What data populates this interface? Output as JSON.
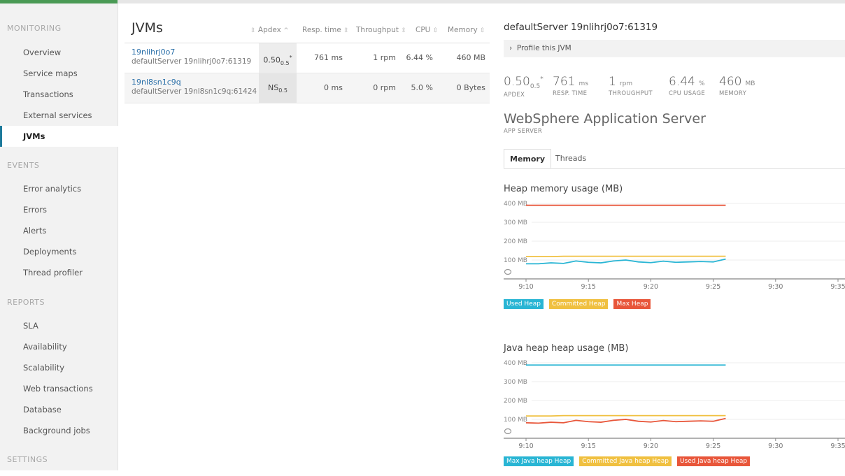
{
  "sidebar": {
    "sections": [
      {
        "label": "MONITORING",
        "items": [
          "Overview",
          "Service maps",
          "Transactions",
          "External services",
          "JVMs"
        ]
      },
      {
        "label": "EVENTS",
        "items": [
          "Error analytics",
          "Errors",
          "Alerts",
          "Deployments",
          "Thread profiler"
        ]
      },
      {
        "label": "REPORTS",
        "items": [
          "SLA",
          "Availability",
          "Scalability",
          "Web transactions",
          "Database",
          "Background jobs"
        ]
      },
      {
        "label": "SETTINGS",
        "items": []
      }
    ],
    "active_item": "JVMs"
  },
  "jvm_table": {
    "title": "JVMs",
    "columns": [
      "Apdex",
      "Resp. time",
      "Throughput",
      "CPU",
      "Memory"
    ],
    "rows": [
      {
        "name": "19nlihrj0o7",
        "server": "defaultServer 19nlihrj0o7:61319",
        "apdex": "0.50",
        "apdex_t": "0.5",
        "apdex_star": "*",
        "resp": "761 ms",
        "throughput": "1 rpm",
        "cpu": "6.44 %",
        "memory": "460 MB"
      },
      {
        "name": "19nl8sn1c9q",
        "server": "defaultServer 19nl8sn1c9q:61424",
        "apdex": "NS",
        "apdex_t": "0.5",
        "apdex_star": "",
        "resp": "0 ms",
        "throughput": "0 rpm",
        "cpu": "5.0 %",
        "memory": "0 Bytes"
      }
    ]
  },
  "detail": {
    "title": "defaultServer 19nlihrj0o7:61319",
    "profile_link": "Profile this JVM",
    "metrics": [
      {
        "value": "0.50",
        "sub": "0.5",
        "star": "*",
        "unit": "",
        "label": "APDEX"
      },
      {
        "value": "761",
        "unit": "ms",
        "label": "RESP. TIME"
      },
      {
        "value": "1",
        "unit": "rpm",
        "label": "THROUGHPUT"
      },
      {
        "value": "6.44",
        "unit": "%",
        "label": "CPU USAGE"
      },
      {
        "value": "460",
        "unit": "MB",
        "label": "MEMORY"
      }
    ],
    "server_name": "WebSphere Application Server",
    "server_kind": "APP SERVER",
    "tabs": [
      "Memory",
      "Threads"
    ],
    "active_tab": "Memory"
  },
  "chart_data": [
    {
      "type": "line",
      "title": "Heap memory usage (MB)",
      "ylim": [
        0,
        400
      ],
      "yticks": [
        "400 MB",
        "300 MB",
        "200 MB",
        "100 MB"
      ],
      "ytick_values": [
        400,
        300,
        200,
        100
      ],
      "xticks": [
        "9:10",
        "9:15",
        "9:20",
        "9:25",
        "9:30",
        "9:35"
      ],
      "x": [
        "9:10",
        "9:11",
        "9:12",
        "9:13",
        "9:14",
        "9:15",
        "9:16",
        "9:17",
        "9:18",
        "9:19",
        "9:20",
        "9:21",
        "9:22",
        "9:23",
        "9:24",
        "9:25",
        "9:26"
      ],
      "series": [
        {
          "name": "Used Heap",
          "color": "#29b5d4",
          "values": [
            80,
            80,
            85,
            82,
            95,
            88,
            85,
            95,
            100,
            90,
            86,
            94,
            88,
            90,
            92,
            90,
            105
          ]
        },
        {
          "name": "Committed Heap",
          "color": "#f0c040",
          "values": [
            118,
            118,
            118,
            120,
            120,
            120,
            120,
            120,
            120,
            120,
            120,
            120,
            120,
            120,
            120,
            120,
            120
          ]
        },
        {
          "name": "Max Heap",
          "color": "#e8563a",
          "values": [
            390,
            390,
            390,
            390,
            390,
            390,
            390,
            390,
            390,
            390,
            390,
            390,
            390,
            390,
            390,
            390,
            390
          ]
        }
      ]
    },
    {
      "type": "line",
      "title": "Java heap heap usage (MB)",
      "ylim": [
        0,
        400
      ],
      "yticks": [
        "400 MB",
        "300 MB",
        "200 MB",
        "100 MB"
      ],
      "ytick_values": [
        400,
        300,
        200,
        100
      ],
      "xticks": [
        "9:10",
        "9:15",
        "9:20",
        "9:25",
        "9:30",
        "9:35"
      ],
      "x": [
        "9:10",
        "9:11",
        "9:12",
        "9:13",
        "9:14",
        "9:15",
        "9:16",
        "9:17",
        "9:18",
        "9:19",
        "9:20",
        "9:21",
        "9:22",
        "9:23",
        "9:24",
        "9:25",
        "9:26"
      ],
      "series": [
        {
          "name": "Max Java heap Heap",
          "color": "#29b5d4",
          "values": [
            388,
            388,
            388,
            388,
            388,
            388,
            388,
            388,
            388,
            388,
            388,
            388,
            388,
            388,
            388,
            388,
            388
          ]
        },
        {
          "name": "Committed Java heap Heap",
          "color": "#f0c040",
          "values": [
            118,
            118,
            118,
            120,
            120,
            120,
            120,
            120,
            120,
            120,
            120,
            120,
            120,
            120,
            120,
            120,
            120
          ]
        },
        {
          "name": "Used Java heap Heap",
          "color": "#e8563a",
          "values": [
            82,
            80,
            85,
            82,
            95,
            88,
            85,
            95,
            100,
            90,
            86,
            94,
            88,
            90,
            92,
            90,
            105
          ]
        }
      ]
    }
  ]
}
